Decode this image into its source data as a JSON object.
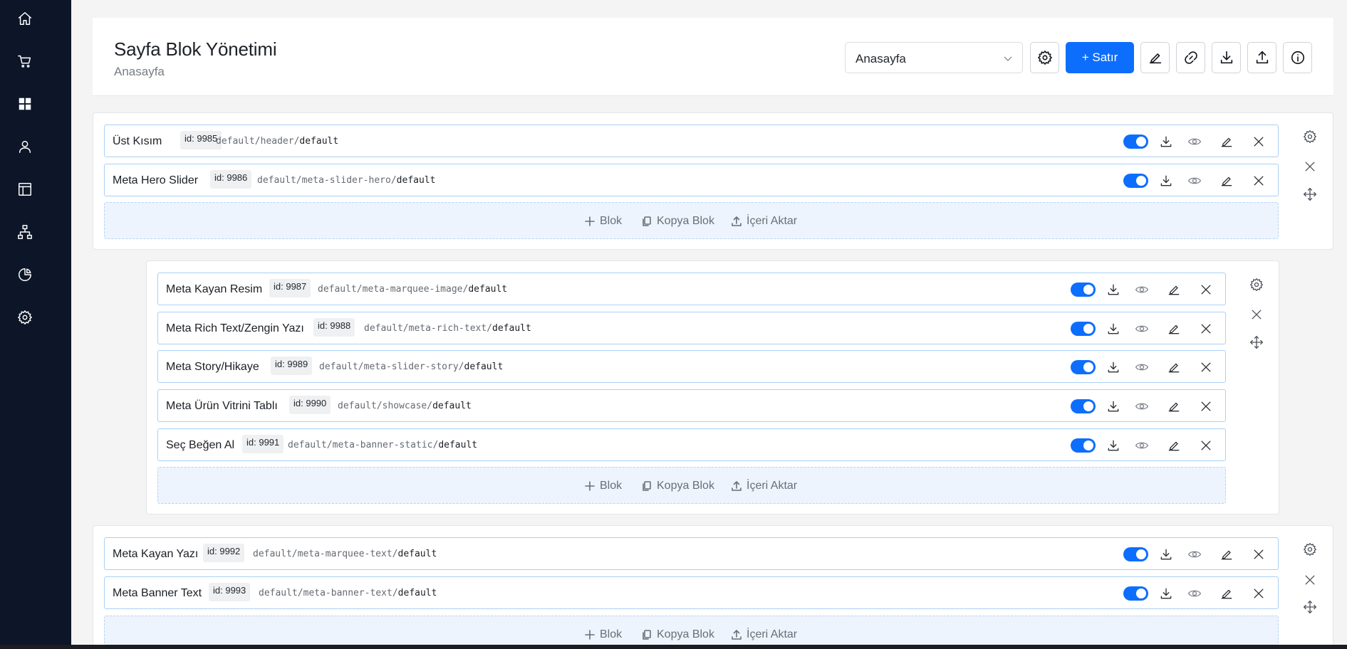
{
  "header": {
    "title": "Sayfa Blok Yönetimi",
    "subtitle": "Anasayfa",
    "page_select_value": "Anasayfa",
    "add_row_label": "+ Satır"
  },
  "actions": {
    "block": "Blok",
    "copy_block": "Kopya Blok",
    "import": "İçeri Aktar"
  },
  "sections": [
    {
      "blocks": [
        {
          "name": "Üst Kısım",
          "id": "id: 9985",
          "path": "default/header/",
          "leaf": "default"
        },
        {
          "name": "Meta Hero Slider",
          "id": "id: 9986",
          "path": "default/meta-slider-hero/",
          "leaf": "default"
        }
      ]
    },
    {
      "blocks": [
        {
          "name": "Meta Kayan Resim",
          "id": "id: 9987",
          "path": "default/meta-marquee-image/",
          "leaf": "default"
        },
        {
          "name": "Meta Rich Text/Zengin Yazı",
          "id": "id: 9988",
          "path": "default/meta-rich-text/",
          "leaf": "default"
        },
        {
          "name": "Meta Story/Hikaye",
          "id": "id: 9989",
          "path": "default/meta-slider-story/",
          "leaf": "default"
        },
        {
          "name": "Meta Ürün Vitrini Tablı",
          "id": "id: 9990",
          "path": "default/showcase/",
          "leaf": "default"
        },
        {
          "name": "Seç Beğen Al",
          "id": "id: 9991",
          "path": "default/meta-banner-static/",
          "leaf": "default"
        }
      ]
    },
    {
      "blocks": [
        {
          "name": "Meta Kayan Yazı",
          "id": "id: 9992",
          "path": "default/meta-marquee-text/",
          "leaf": "default"
        },
        {
          "name": "Meta Banner Text",
          "id": "id: 9993",
          "path": "default/meta-banner-text/",
          "leaf": "default"
        }
      ]
    }
  ],
  "colors": {
    "sidebar": "#0c1628",
    "accent": "#0d6efd",
    "row_border": "#a9d0f5",
    "action_bar_bg": "#edf4fd"
  },
  "icons": {
    "sidebar": [
      "home-icon",
      "cart-icon",
      "dashboard-icon",
      "user-icon",
      "layout-icon",
      "sitemap-icon",
      "chart-pie-icon",
      "settings-icon"
    ],
    "header_buttons": [
      "gear-icon",
      "pencil-icon",
      "link-icon",
      "download-icon",
      "upload-icon",
      "info-icon"
    ],
    "row_actions": [
      "toggle-switch",
      "download-icon",
      "eye-icon",
      "pencil-icon",
      "close-icon"
    ]
  }
}
